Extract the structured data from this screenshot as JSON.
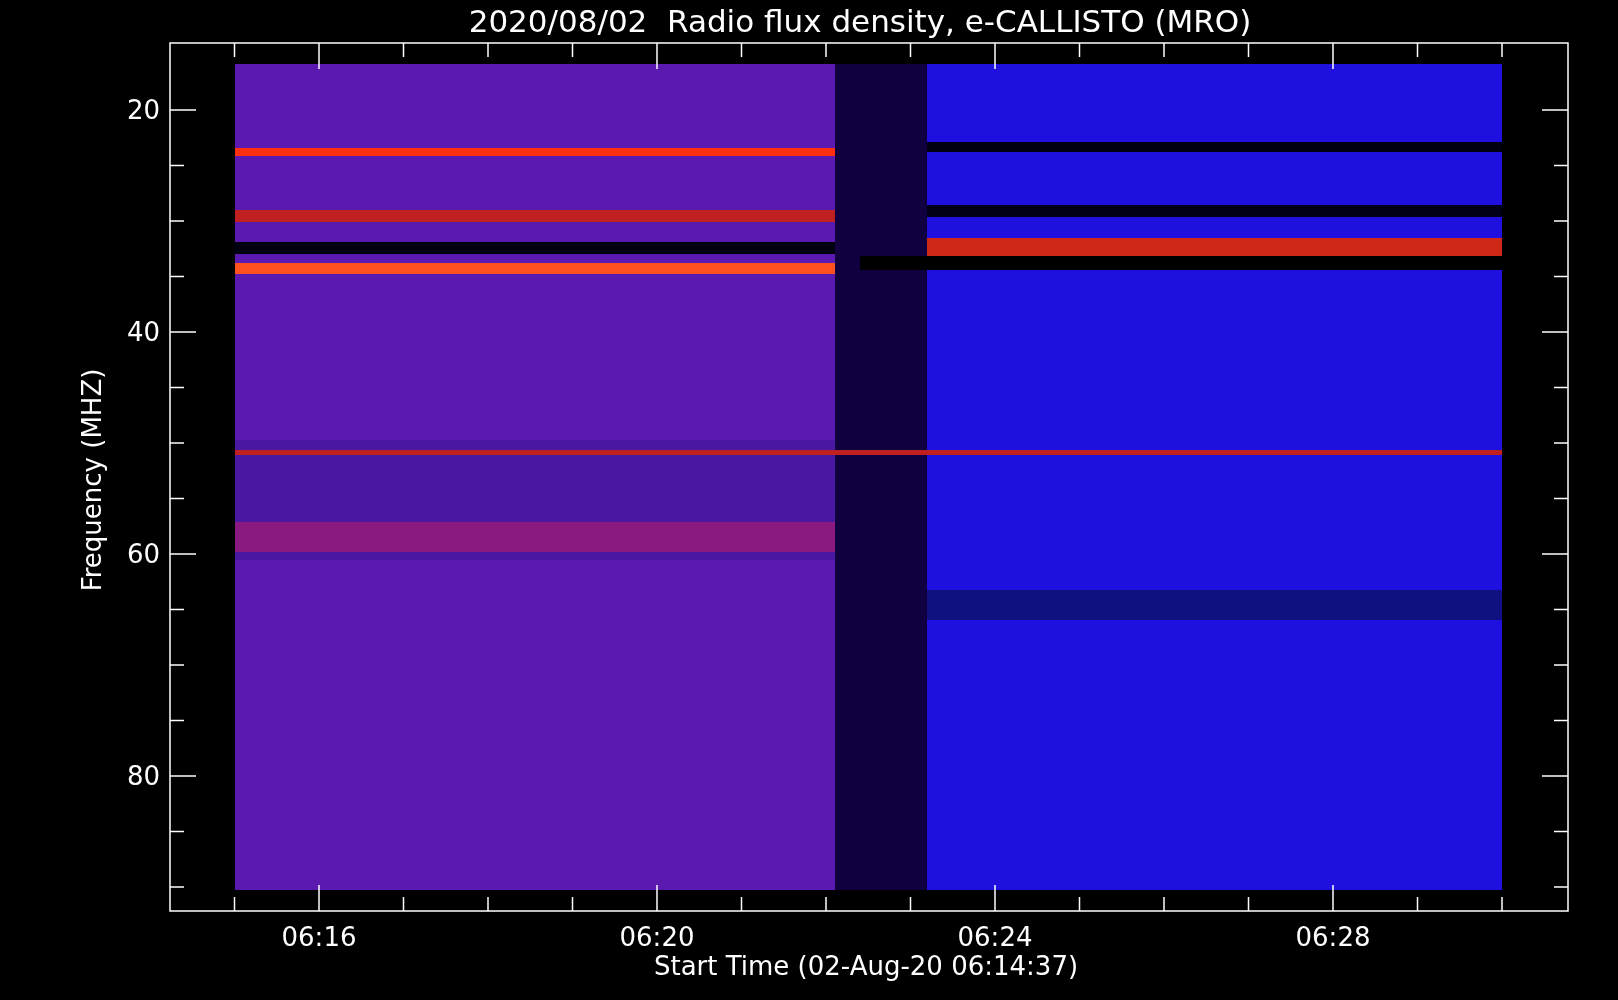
{
  "title": "2020/08/02  Radio flux density, e-CALLISTO (MRO)",
  "y_axis": {
    "label": "Frequency (MHZ)",
    "ticks": [
      "20",
      "40",
      "60",
      "80"
    ]
  },
  "x_axis": {
    "label": "Start Time (02-Aug-20 06:14:37)",
    "ticks": [
      "06:16",
      "06:20",
      "06:24",
      "06:28"
    ]
  }
}
